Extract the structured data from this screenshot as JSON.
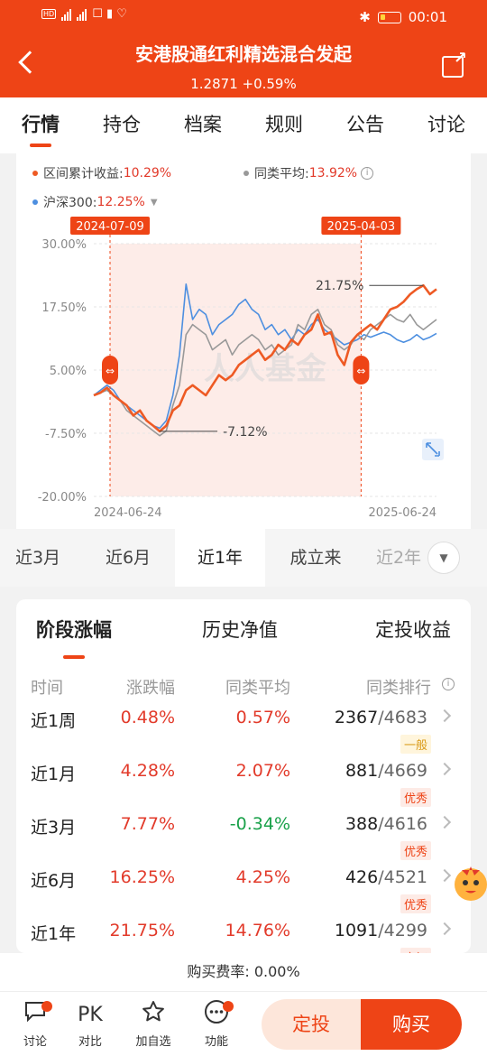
{
  "status_bar": {
    "time": "00:01",
    "network": "4G"
  },
  "header": {
    "title": "安港股通红利精选混合发起",
    "nav": "1.2871 +0.59%"
  },
  "tabs": [
    "行情",
    "持仓",
    "档案",
    "规则",
    "公告",
    "讨论"
  ],
  "legend": {
    "fund_label": "区间累计收益:",
    "fund_value": "10.29%",
    "peer_label": "同类平均:",
    "peer_value": "13.92%",
    "index_label": "沪深300:",
    "index_value": "12.25%"
  },
  "colors": {
    "brand": "#ee4416",
    "fund": "#ee5a24",
    "peer": "#999999",
    "index": "#4d8fe0",
    "up": "#e23a2a",
    "down": "#1aa14a"
  },
  "chart_data": {
    "type": "line",
    "x_start": "2024-06-24",
    "x_end": "2025-06-24",
    "xticks": [
      "2024-06-24",
      "2025-06-24"
    ],
    "yticks": [
      "30.00%",
      "17.50%",
      "5.00%",
      "-7.50%",
      "-20.00%"
    ],
    "ylim": [
      -20,
      30
    ],
    "range_start_label": "2024-07-09",
    "range_end_label": "2025-04-03",
    "max_label": "21.75%",
    "min_label": "-7.12%",
    "watermark": "人人基金",
    "series": [
      {
        "name": "区间累计收益",
        "color": "#ee5a24",
        "values": [
          0,
          0.5,
          1.5,
          0,
          -1,
          -2,
          -4,
          -3,
          -5,
          -6,
          -7.12,
          -6,
          -3,
          -2,
          1,
          2,
          1,
          0,
          2,
          4,
          3,
          4,
          6,
          7,
          8,
          9,
          7,
          8,
          10,
          9,
          11,
          10,
          12,
          13,
          16,
          12,
          12.5,
          8,
          6,
          10.5,
          12,
          13,
          14,
          13,
          15,
          17,
          17.5,
          18.5,
          20,
          21,
          21.75,
          20,
          21
        ]
      },
      {
        "name": "同类平均",
        "color": "#999999",
        "values": [
          0,
          0.5,
          1,
          0,
          -1,
          -3,
          -4,
          -5,
          -6,
          -7,
          -8,
          -7,
          -2,
          2,
          12,
          14,
          13,
          12,
          9,
          10,
          11,
          8,
          10,
          11,
          12,
          11,
          9,
          10,
          8,
          9,
          10,
          14,
          13,
          16,
          17,
          14,
          13,
          10,
          9,
          10,
          12,
          11,
          13,
          14,
          15,
          16,
          15,
          14.5,
          16,
          14,
          13,
          14,
          15
        ]
      },
      {
        "name": "沪深300",
        "color": "#4d8fe0",
        "values": [
          0,
          1,
          2,
          1,
          -1,
          -2,
          -3,
          -4,
          -5,
          -6,
          -6.5,
          -5,
          0,
          8,
          22,
          15,
          17,
          16,
          12,
          14,
          15,
          16,
          18,
          19,
          17,
          16,
          13,
          14,
          12,
          13,
          11,
          13,
          12,
          14,
          15,
          13,
          12,
          11,
          10,
          10.5,
          11,
          12,
          11.5,
          12,
          12.5,
          12,
          11,
          10.5,
          11,
          12,
          11,
          11.5,
          12.25
        ]
      }
    ]
  },
  "range_options": [
    "近3月",
    "近6月",
    "近1年",
    "成立来",
    "近2年"
  ],
  "perf_tabs": [
    "阶段涨幅",
    "历史净值",
    "定投收益"
  ],
  "perf_headers": [
    "时间",
    "涨跌幅",
    "同类平均",
    "同类排行"
  ],
  "perf_rows": [
    {
      "period": "近1周",
      "change": "0.48%",
      "avg": "0.57%",
      "rank": "2367",
      "total": "/4683",
      "badge": "一般",
      "badge_type": "normal"
    },
    {
      "period": "近1月",
      "change": "4.28%",
      "avg": "2.07%",
      "rank": "881",
      "total": "/4669",
      "badge": "优秀",
      "badge_type": "good"
    },
    {
      "period": "近3月",
      "change": "7.77%",
      "avg": "-0.34%",
      "rank": "388",
      "total": "/4616",
      "badge": "优秀",
      "badge_type": "good"
    },
    {
      "period": "近6月",
      "change": "16.25%",
      "avg": "4.25%",
      "rank": "426",
      "total": "/4521",
      "badge": "优秀",
      "badge_type": "good"
    },
    {
      "period": "近1年",
      "change": "21.75%",
      "avg": "14.76%",
      "rank": "1091",
      "total": "/4299",
      "badge": "良好",
      "badge_type": "good"
    }
  ],
  "fee": "购买费率: 0.00%",
  "bottom_nav": [
    {
      "icon": "chat-icon",
      "label": "讨论"
    },
    {
      "icon": "pk-icon",
      "label": "对比",
      "glyph": "PK"
    },
    {
      "icon": "star-icon",
      "label": "加自选"
    },
    {
      "icon": "more-icon",
      "label": "功能"
    }
  ],
  "buttons": {
    "dingtou": "定投",
    "buy": "购买"
  }
}
